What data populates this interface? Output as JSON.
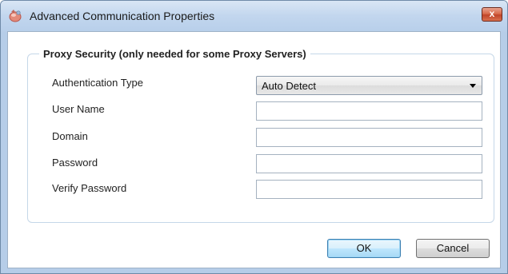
{
  "window": {
    "title": "Advanced Communication Properties",
    "close_label": "x"
  },
  "group": {
    "title": "Proxy Security (only needed for some Proxy Servers)"
  },
  "fields": {
    "auth_type_label": "Authentication Type",
    "auth_type_value": "Auto Detect",
    "user_name_label": "User Name",
    "user_name_value": "",
    "domain_label": "Domain",
    "domain_value": "",
    "password_label": "Password",
    "password_value": "",
    "verify_password_label": "Verify Password",
    "verify_password_value": ""
  },
  "buttons": {
    "ok_label": "OK",
    "cancel_label": "Cancel"
  },
  "icons": {
    "app_icon": "communication-app-icon",
    "close_icon": "close-icon",
    "dropdown_icon": "chevron-down-icon"
  },
  "colors": {
    "titlebar": "#c2d6ee",
    "close_button": "#c0452a",
    "group_border": "#c5d7e8",
    "ok_button_border": "#3c7fb1"
  }
}
